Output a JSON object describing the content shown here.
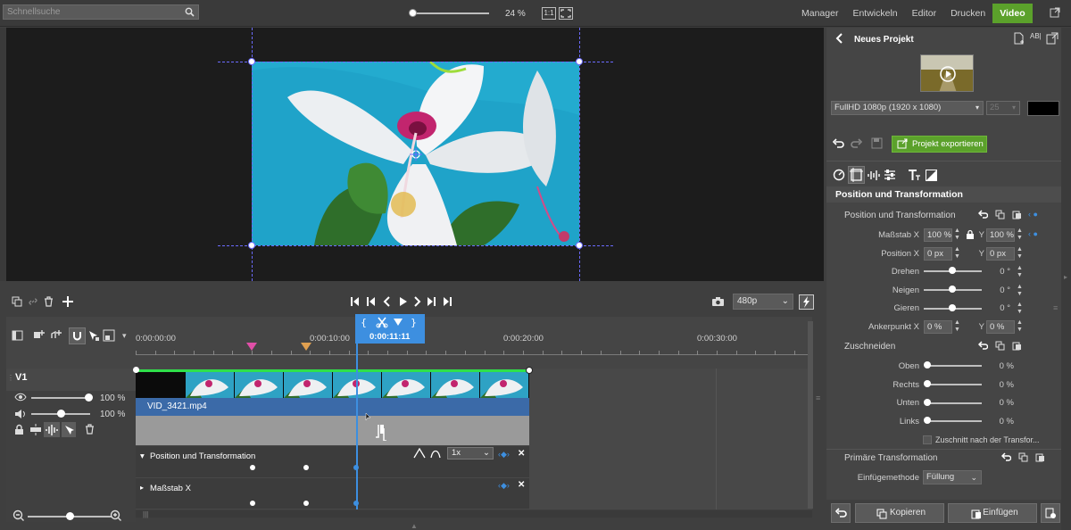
{
  "search": {
    "placeholder": "Schnellsuche"
  },
  "zoom": {
    "percent_label": "24 %"
  },
  "tabs": [
    {
      "label": "Manager"
    },
    {
      "label": "Entwickeln"
    },
    {
      "label": "Editor"
    },
    {
      "label": "Drucken"
    },
    {
      "label": "Video"
    }
  ],
  "transport": {
    "resolution": "480p"
  },
  "timeline": {
    "ruler_labels": [
      "0:00:00:00",
      "0:00:10:00",
      "0:00:20:00",
      "0:00:30:00"
    ],
    "playhead_time": "0:00:11:11",
    "track_name": "V1",
    "opacity_value": "100 %",
    "volume_value": "100 %",
    "clip_name": "VID_3421.mp4",
    "kf_track1": "Position und Transformation",
    "kf_track2": "Maßstab X",
    "speed_value": "1x"
  },
  "panel": {
    "project_title": "Neues Projekt",
    "format": "FullHD 1080p (1920 x 1080)",
    "fps": "25",
    "export_label": "Projekt exportieren",
    "section_title": "Position und Transformation",
    "group1": "Position und Transformation",
    "scale_x_label": "Maßstab X",
    "scale_x_val": "100 %",
    "y_label": "Y",
    "scale_y_val": "100 %",
    "pos_x_label": "Position X",
    "pos_x_val": "0 px",
    "pos_y_val": "0 px",
    "rotate_label": "Drehen",
    "rotate_val": "0 °",
    "tilt_label": "Neigen",
    "tilt_val": "0 °",
    "yaw_label": "Gieren",
    "yaw_val": "0 °",
    "anchor_label": "Ankerpunkt X",
    "anchor_x_val": "0 %",
    "anchor_y_val": "0 %",
    "crop_title": "Zuschneiden",
    "crop_top_label": "Oben",
    "crop_right_label": "Rechts",
    "crop_bottom_label": "Unten",
    "crop_left_label": "Links",
    "crop_val": "0 %",
    "crop_checkbox": "Zuschnitt nach der Transfor...",
    "primary_title": "Primäre Transformation",
    "insert_label": "Einfügemethode",
    "insert_val": "Füllung",
    "copy_label": "Kopieren",
    "paste_label": "Einfügen"
  },
  "colors": {
    "accent_green": "#5ba12b",
    "playhead_blue": "#3d8fe0",
    "guide_blue": "#6b6bff",
    "clip_blue": "#3b6aa8"
  }
}
